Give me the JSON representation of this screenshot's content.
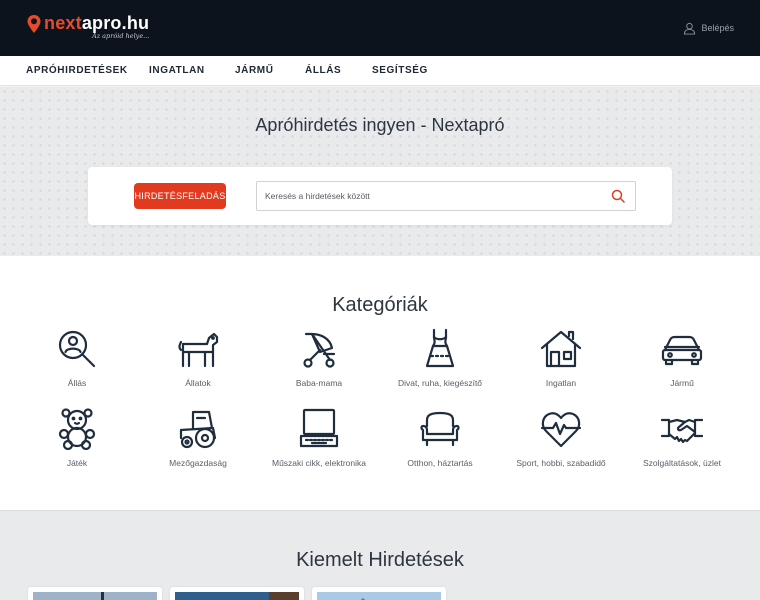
{
  "header": {
    "logo_text_a": "next",
    "logo_text_b": "apro.hu",
    "logo_tagline": "Az apróid helye...",
    "login_label": "Belépés"
  },
  "nav": {
    "items": [
      "APRÓHIRDETÉSEK",
      "INGATLAN",
      "JÁRMŰ",
      "ÁLLÁS",
      "SEGÍTSÉG"
    ]
  },
  "hero": {
    "title": "Apróhirdetés ingyen - Nextapró",
    "post_button": "HIRDETÉSFELADÁS",
    "search_placeholder": "Keresés a hirdetések között"
  },
  "categories": {
    "title": "Kategóriák",
    "items": [
      {
        "label": "Állás",
        "icon": "job-search-icon"
      },
      {
        "label": "Állatok",
        "icon": "dog-icon"
      },
      {
        "label": "Baba-mama",
        "icon": "stroller-icon"
      },
      {
        "label": "Divat, ruha, kiegészítő",
        "icon": "dress-icon"
      },
      {
        "label": "Ingatlan",
        "icon": "house-icon"
      },
      {
        "label": "Jármű",
        "icon": "car-icon"
      },
      {
        "label": "Játék",
        "icon": "teddy-bear-icon"
      },
      {
        "label": "Mezőgazdaság",
        "icon": "tractor-icon"
      },
      {
        "label": "Műszaki cikk, elektronika",
        "icon": "laptop-icon"
      },
      {
        "label": "Otthon, háztartás",
        "icon": "armchair-icon"
      },
      {
        "label": "Sport, hobbi, szabadidő",
        "icon": "heart-pulse-icon"
      },
      {
        "label": "Szolgáltatások, üzlet",
        "icon": "handshake-icon"
      }
    ]
  },
  "featured": {
    "title": "Kiemelt Hirdetések"
  },
  "colors": {
    "header_bg": "#0c131d",
    "brand_red": "#e23a1f",
    "icon_navy": "#1f2d3d"
  }
}
